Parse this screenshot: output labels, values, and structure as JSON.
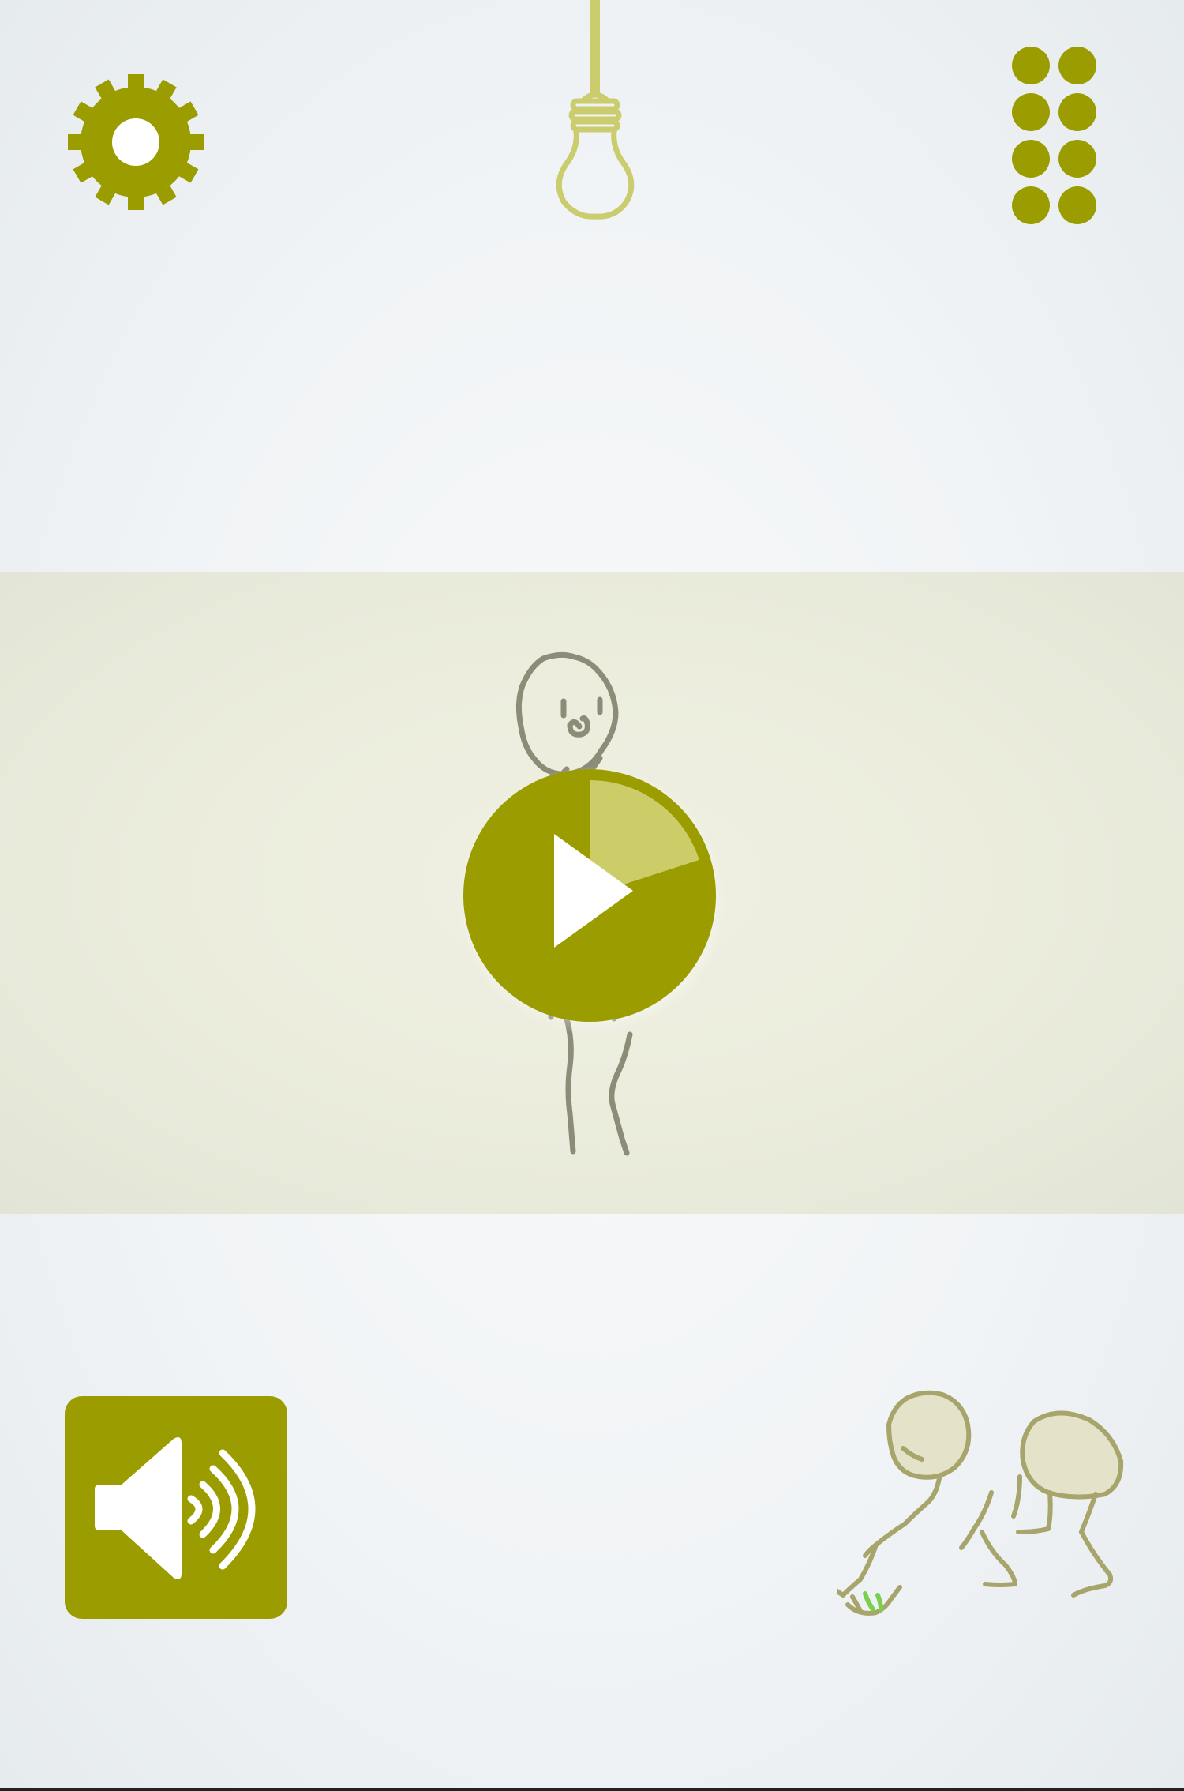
{
  "colors": {
    "accent": "#9a9c00",
    "accent_light": "#cccd69",
    "bulb": "#cbcc6e",
    "figure_stroke": "#8c8c78",
    "creature_stroke": "#a8a56c",
    "creature_fill": "#e4e2c8",
    "sprout": "#7ad04a"
  },
  "icons": {
    "settings": "gear-icon",
    "hint": "lightbulb-icon",
    "levels": "grid-dots-icon",
    "play": "play-icon",
    "sound": "speaker-icon"
  },
  "progress": {
    "level_fraction": 0.2
  },
  "sound": {
    "enabled": true
  }
}
